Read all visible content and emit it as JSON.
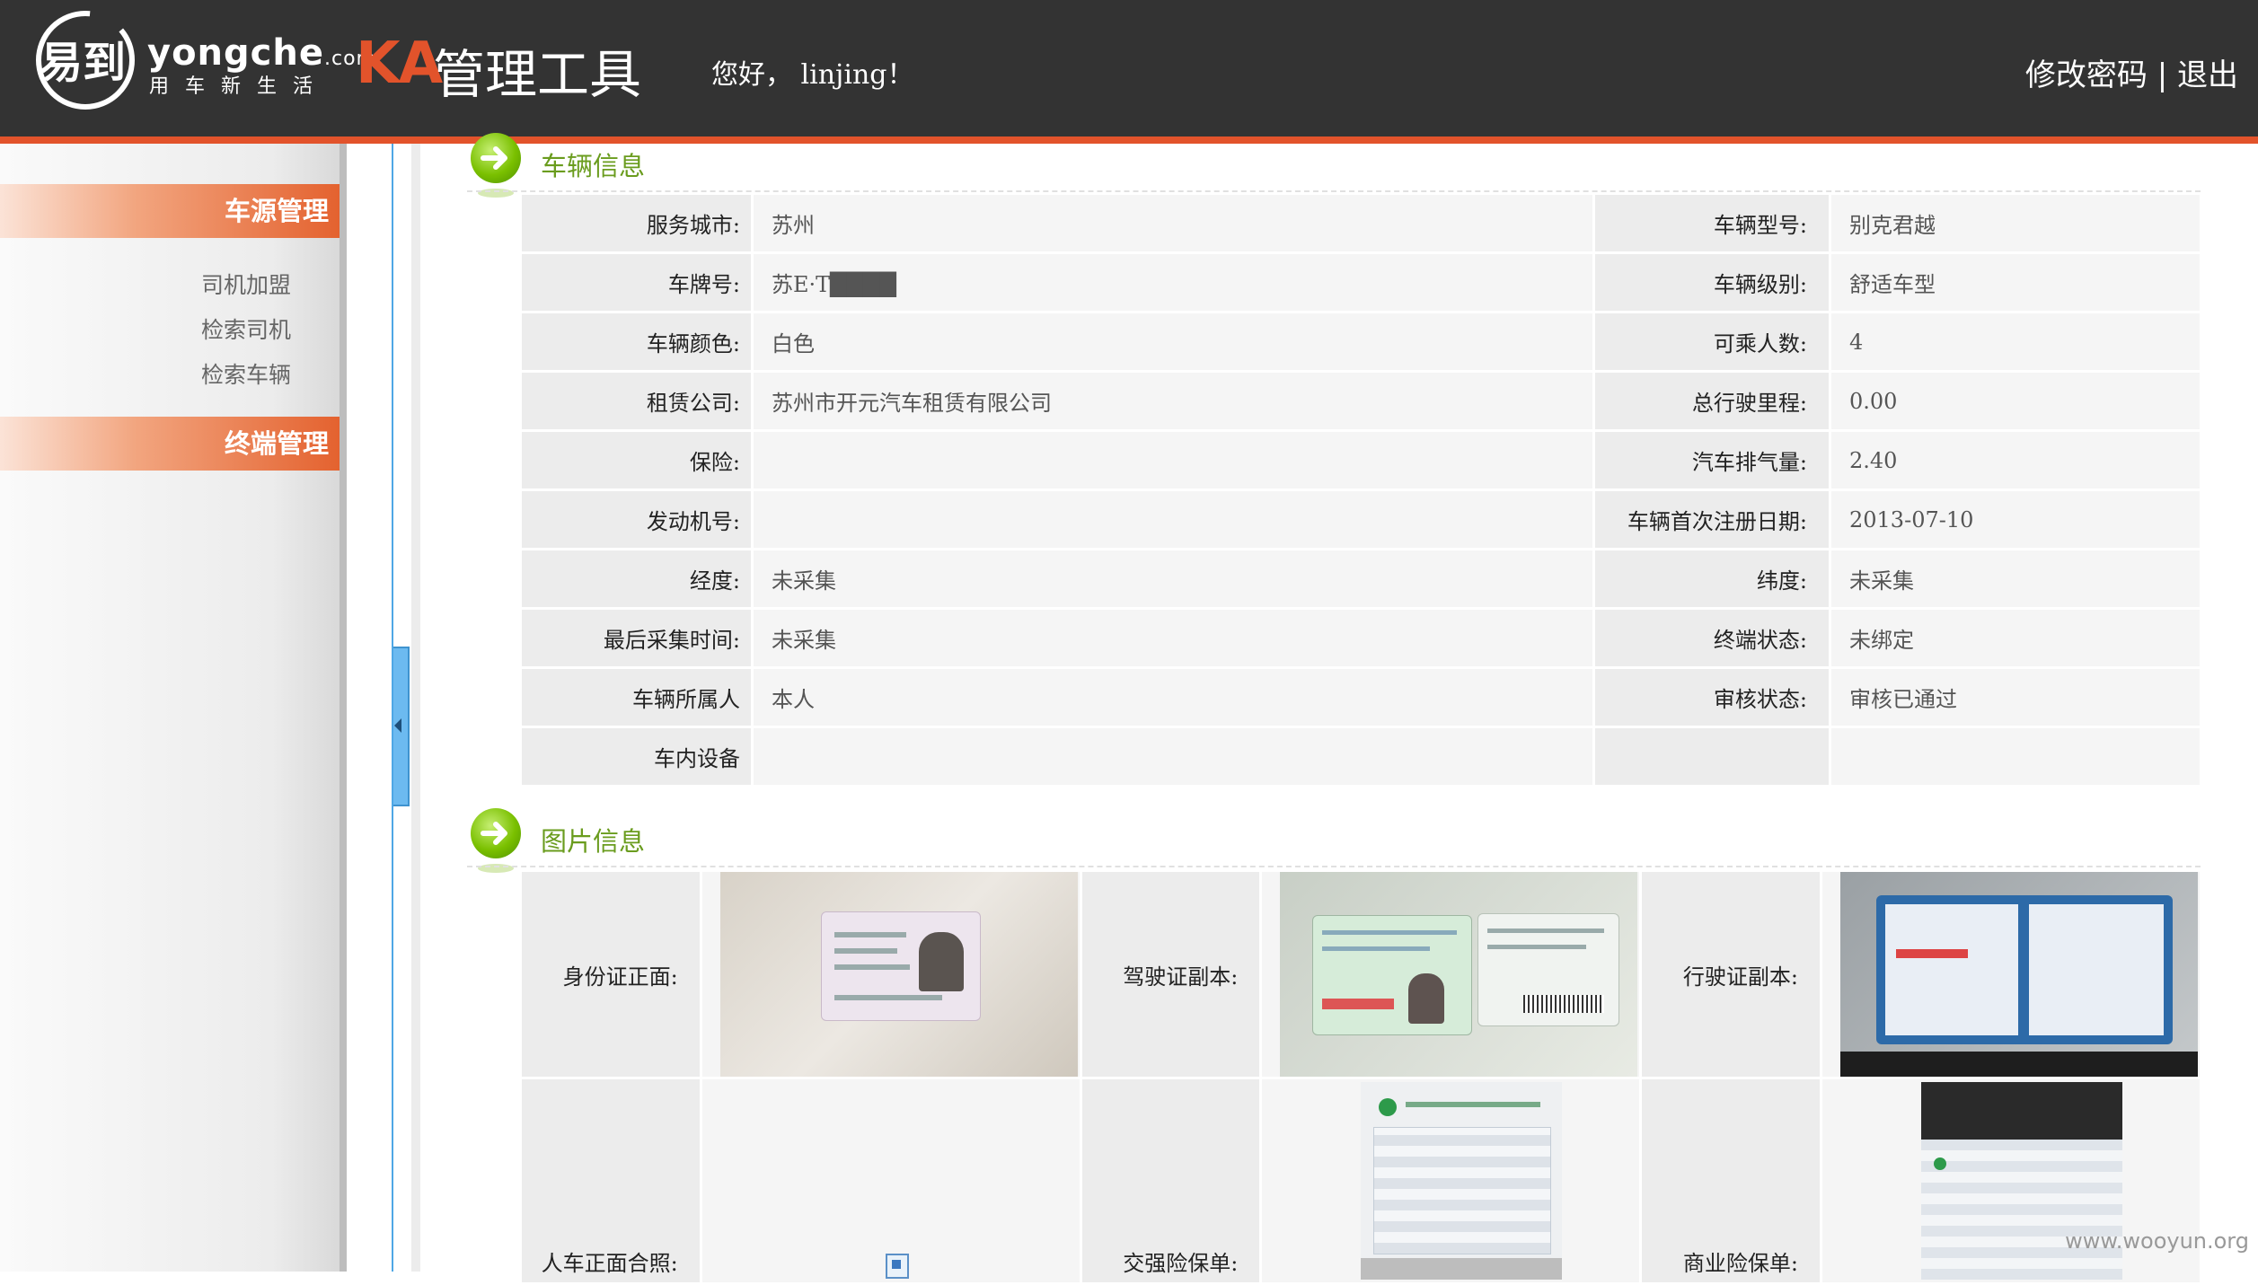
{
  "header": {
    "logo_brand": "易到",
    "logo_site": "yongche",
    "logo_domain": ".com",
    "logo_slogan": "用车新生活",
    "ka": "KA",
    "tool_name": "管理工具",
    "greeting": "您好， linjing！",
    "change_password": "修改密码",
    "separator": " | ",
    "logout": "退出"
  },
  "sidebar": {
    "section1": "车源管理",
    "items": [
      "司机加盟",
      "检索司机",
      "检索车辆"
    ],
    "section2": "终端管理"
  },
  "vehicle_section": {
    "title": "车辆信息",
    "rows": [
      {
        "l1": "服务城市:",
        "v1": "苏州",
        "l2": "车辆型号:",
        "v2": "别克君越"
      },
      {
        "l1": "车牌号:",
        "v1": "苏E·T████",
        "l2": "车辆级别:",
        "v2": "舒适车型"
      },
      {
        "l1": "车辆颜色:",
        "v1": "白色",
        "l2": "可乘人数:",
        "v2": "4"
      },
      {
        "l1": "租赁公司:",
        "v1": "苏州市开元汽车租赁有限公司",
        "l2": "总行驶里程:",
        "v2": "0.00"
      },
      {
        "l1": "保险:",
        "v1": "",
        "l2": "汽车排气量:",
        "v2": "2.40"
      },
      {
        "l1": "发动机号:",
        "v1": "",
        "l2": "车辆首次注册日期:",
        "v2": "2013-07-10"
      },
      {
        "l1": "经度:",
        "v1": "未采集",
        "l2": "纬度:",
        "v2": "未采集"
      },
      {
        "l1": "最后采集时间:",
        "v1": "未采集",
        "l2": "终端状态:",
        "v2": "未绑定"
      },
      {
        "l1": "车辆所属人",
        "v1": "本人",
        "l2": "审核状态:",
        "v2": "审核已通过"
      },
      {
        "l1": "车内设备",
        "v1": "",
        "l2": "",
        "v2": ""
      }
    ]
  },
  "photo_section": {
    "title": "图片信息",
    "row1": [
      "身份证正面:",
      "驾驶证副本:",
      "行驶证副本:"
    ],
    "row2": [
      "人车正面合照:",
      "交强险保单:",
      "商业险保单:"
    ]
  },
  "watermark": "www.wooyun.org"
}
